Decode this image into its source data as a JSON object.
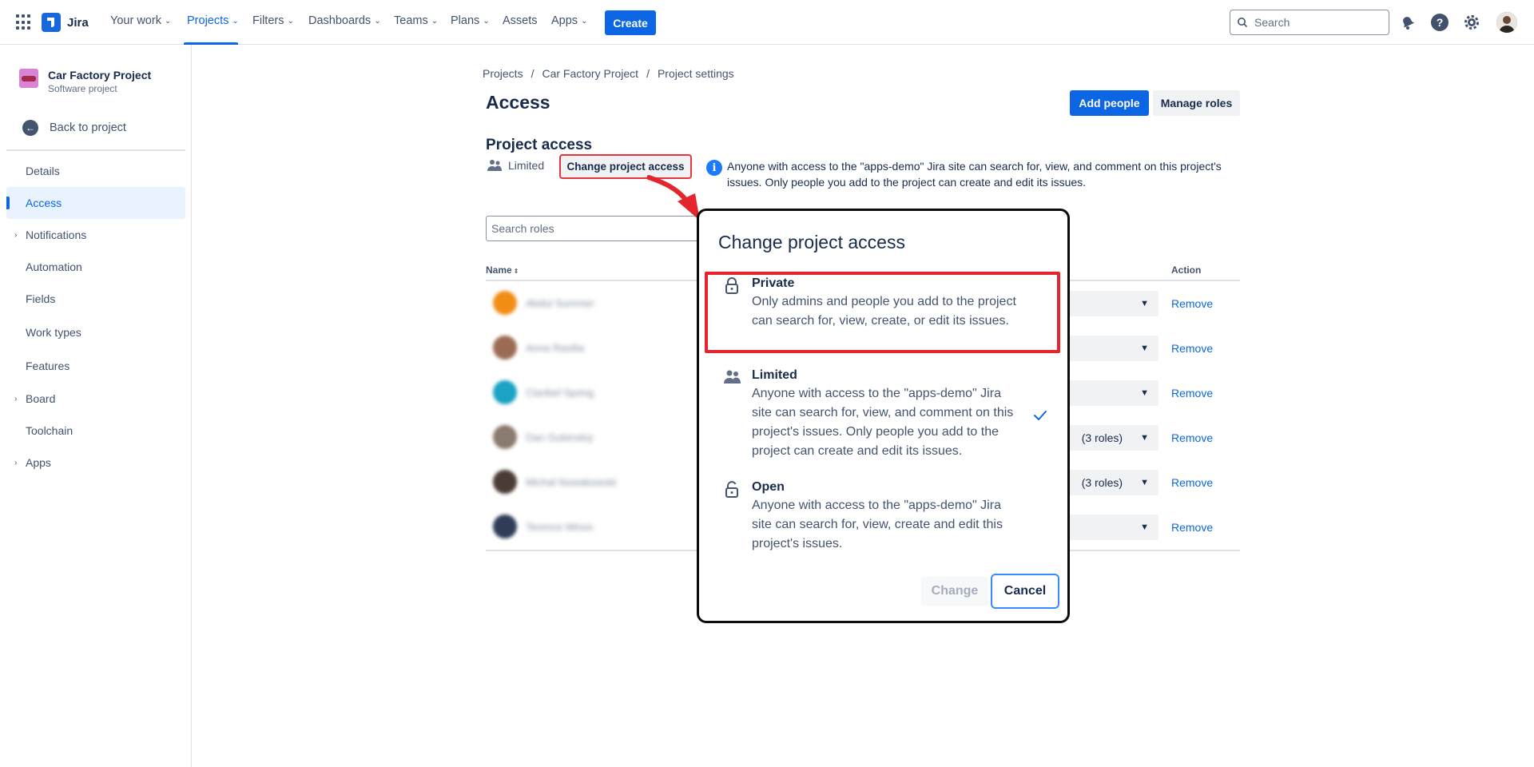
{
  "topnav": {
    "logo_text": "Jira",
    "items": [
      {
        "label": "Your work"
      },
      {
        "label": "Projects"
      },
      {
        "label": "Filters"
      },
      {
        "label": "Dashboards"
      },
      {
        "label": "Teams"
      },
      {
        "label": "Plans"
      },
      {
        "label": "Assets"
      },
      {
        "label": "Apps"
      }
    ],
    "active_item": "Projects",
    "create_label": "Create",
    "search_placeholder": "Search"
  },
  "sidebar": {
    "project_name": "Car Factory Project",
    "project_type": "Software project",
    "back_label": "Back to project",
    "items": [
      {
        "label": "Details"
      },
      {
        "label": "Access"
      },
      {
        "label": "Notifications"
      },
      {
        "label": "Automation"
      },
      {
        "label": "Fields"
      },
      {
        "label": "Work types"
      },
      {
        "label": "Features"
      },
      {
        "label": "Board"
      },
      {
        "label": "Toolchain"
      },
      {
        "label": "Apps"
      }
    ],
    "active_item": "Access"
  },
  "breadcrumb": [
    "Projects",
    "Car Factory Project",
    "Project settings"
  ],
  "page": {
    "title": "Access",
    "add_people_label": "Add people",
    "manage_roles_label": "Manage roles",
    "section_title": "Project access",
    "access_level": "Limited",
    "change_access_label": "Change project access",
    "info_text": "Anyone with access to the \"apps-demo\" Jira site can search for, view, and comment on this project's issues. Only people you add to the project can create and edit its issues.",
    "search_roles_placeholder": "Search roles",
    "table": {
      "col_name": "Name",
      "col_action": "Action",
      "rows": [
        {
          "name": "Abdul Summer",
          "role": "",
          "action": "Remove",
          "avatar_color": "#f18d13"
        },
        {
          "name": "Anna Rasilia",
          "role": "",
          "action": "Remove",
          "avatar_color": "#9b6b53"
        },
        {
          "name": "Claribel Spring",
          "role": "",
          "action": "Remove",
          "avatar_color": "#1aa3c4"
        },
        {
          "name": "Dan Gubinskiy",
          "role": "(3 roles)",
          "action": "Remove",
          "avatar_color": "#8a7a70"
        },
        {
          "name": "Michal Nowakowski",
          "role": "(3 roles)",
          "action": "Remove",
          "avatar_color": "#4a3b34"
        },
        {
          "name": "Terence Minos",
          "role": "",
          "action": "Remove",
          "avatar_color": "#2f3b57"
        }
      ]
    }
  },
  "modal": {
    "title": "Change project access",
    "options": [
      {
        "label": "Private",
        "description": "Only admins and people you add to the project can search for, view, create, or edit its issues."
      },
      {
        "label": "Limited",
        "description": "Anyone with access to the \"apps-demo\" Jira site can search for, view, and comment on this project's issues. Only people you add to the project can create and edit its issues."
      },
      {
        "label": "Open",
        "description": "Anyone with access to the \"apps-demo\" Jira site can search for, view, create and edit this project's issues."
      }
    ],
    "selected_option": "Limited",
    "change_label": "Change",
    "cancel_label": "Cancel"
  },
  "colors": {
    "brand": "#0c66e4",
    "annotation": "#e5252e"
  }
}
